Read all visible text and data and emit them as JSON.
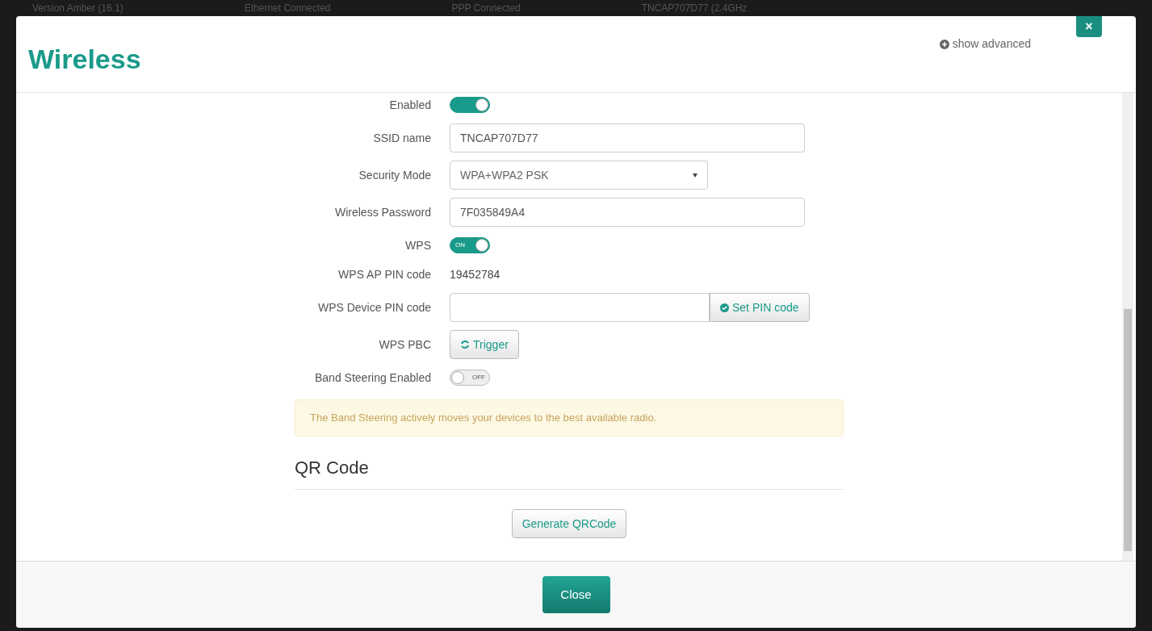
{
  "background_status": [
    "Version Amber (16.1)",
    "Ethernet Connected",
    "PPP Connected",
    "TNCAP707D77 (2.4GHz"
  ],
  "dialog": {
    "title": "Wireless",
    "advanced_link": "show advanced",
    "close_icon": "×"
  },
  "fields": [
    {
      "kind": "toggle",
      "label": "Enabled",
      "on": true
    },
    {
      "kind": "input",
      "label": "SSID name",
      "value": "TNCAP707D77"
    },
    {
      "kind": "select",
      "label": "Security Mode",
      "value": "WPA+WPA2 PSK"
    },
    {
      "kind": "input",
      "label": "Wireless Password",
      "value": "7F035849A4"
    },
    {
      "kind": "toggle",
      "label": "WPS",
      "on": true,
      "text": "ON"
    },
    {
      "kind": "text",
      "label": "WPS AP PIN code",
      "value": "19452784"
    },
    {
      "kind": "input_button",
      "label": "WPS Device PIN code",
      "button": "Set PIN code"
    },
    {
      "kind": "button",
      "label": "WPS PBC",
      "button": "Trigger"
    },
    {
      "kind": "toggle",
      "label": "Band Steering Enabled",
      "on": false,
      "text": "OFF"
    }
  ],
  "notice": "The Band Steering actively moves your devices to the best available radio.",
  "qr_section": {
    "title": "QR Code",
    "button": "Generate QRCode"
  },
  "footer": {
    "button": "Close"
  }
}
